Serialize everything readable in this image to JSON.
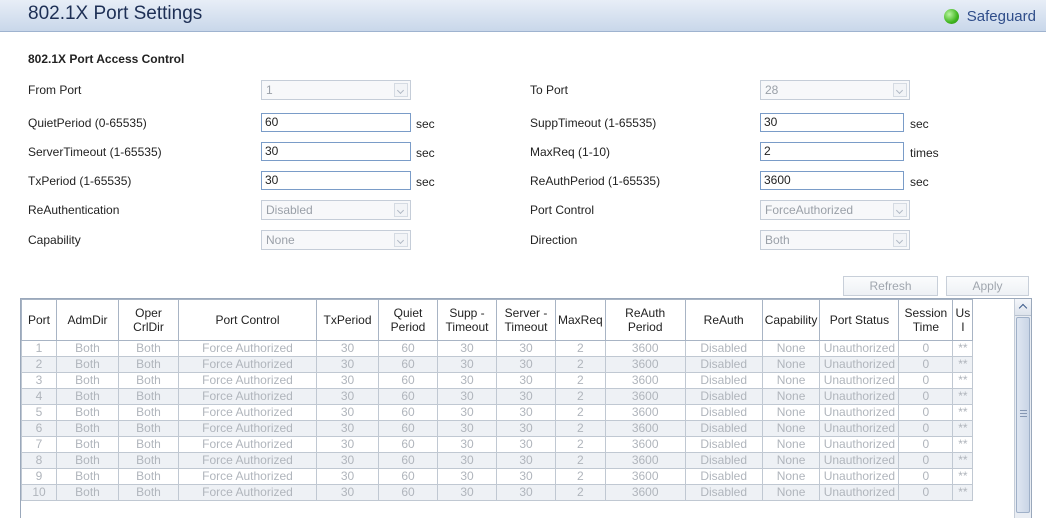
{
  "header": {
    "title": "802.1X Port Settings",
    "safeguard_label": "Safeguard",
    "safeguard_color": "#3fb51e"
  },
  "section": {
    "title": "802.1X Port Access Control"
  },
  "form": {
    "from_port": {
      "label": "From Port",
      "value": "1"
    },
    "to_port": {
      "label": "To Port",
      "value": "28"
    },
    "quiet_period": {
      "label": "QuietPeriod (0-65535)",
      "value": "60",
      "unit": "sec"
    },
    "supp_timeout": {
      "label": "SuppTimeout (1-65535)",
      "value": "30",
      "unit": "sec"
    },
    "server_timeout": {
      "label": "ServerTimeout (1-65535)",
      "value": "30",
      "unit": "sec"
    },
    "max_req": {
      "label": "MaxReq (1-10)",
      "value": "2",
      "unit": "times"
    },
    "tx_period": {
      "label": "TxPeriod (1-65535)",
      "value": "30",
      "unit": "sec"
    },
    "reauth_period": {
      "label": "ReAuthPeriod (1-65535)",
      "value": "3600",
      "unit": "sec"
    },
    "reauthentication": {
      "label": "ReAuthentication",
      "value": "Disabled"
    },
    "port_control": {
      "label": "Port Control",
      "value": "ForceAuthorized"
    },
    "capability": {
      "label": "Capability",
      "value": "None"
    },
    "direction": {
      "label": "Direction",
      "value": "Both"
    }
  },
  "buttons": {
    "refresh": "Refresh",
    "apply": "Apply"
  },
  "table": {
    "headers": [
      "Port",
      "AdmDir",
      "Oper CrlDir",
      "Port Control",
      "TxPeriod",
      "Quiet Period",
      "Supp - Timeout",
      "Server - Timeout",
      "MaxReq",
      "ReAuth Period",
      "ReAuth",
      "Capability",
      "Port Status",
      "Session Time",
      "Us I"
    ],
    "rows": [
      [
        "1",
        "Both",
        "Both",
        "Force Authorized",
        "30",
        "60",
        "30",
        "30",
        "2",
        "3600",
        "Disabled",
        "None",
        "Unauthorized",
        "0",
        "**"
      ],
      [
        "2",
        "Both",
        "Both",
        "Force Authorized",
        "30",
        "60",
        "30",
        "30",
        "2",
        "3600",
        "Disabled",
        "None",
        "Unauthorized",
        "0",
        "**"
      ],
      [
        "3",
        "Both",
        "Both",
        "Force Authorized",
        "30",
        "60",
        "30",
        "30",
        "2",
        "3600",
        "Disabled",
        "None",
        "Unauthorized",
        "0",
        "**"
      ],
      [
        "4",
        "Both",
        "Both",
        "Force Authorized",
        "30",
        "60",
        "30",
        "30",
        "2",
        "3600",
        "Disabled",
        "None",
        "Unauthorized",
        "0",
        "**"
      ],
      [
        "5",
        "Both",
        "Both",
        "Force Authorized",
        "30",
        "60",
        "30",
        "30",
        "2",
        "3600",
        "Disabled",
        "None",
        "Unauthorized",
        "0",
        "**"
      ],
      [
        "6",
        "Both",
        "Both",
        "Force Authorized",
        "30",
        "60",
        "30",
        "30",
        "2",
        "3600",
        "Disabled",
        "None",
        "Unauthorized",
        "0",
        "**"
      ],
      [
        "7",
        "Both",
        "Both",
        "Force Authorized",
        "30",
        "60",
        "30",
        "30",
        "2",
        "3600",
        "Disabled",
        "None",
        "Unauthorized",
        "0",
        "**"
      ],
      [
        "8",
        "Both",
        "Both",
        "Force Authorized",
        "30",
        "60",
        "30",
        "30",
        "2",
        "3600",
        "Disabled",
        "None",
        "Unauthorized",
        "0",
        "**"
      ],
      [
        "9",
        "Both",
        "Both",
        "Force Authorized",
        "30",
        "60",
        "30",
        "30",
        "2",
        "3600",
        "Disabled",
        "None",
        "Unauthorized",
        "0",
        "**"
      ],
      [
        "10",
        "Both",
        "Both",
        "Force Authorized",
        "30",
        "60",
        "30",
        "30",
        "2",
        "3600",
        "Disabled",
        "None",
        "Unauthorized",
        "0",
        "**"
      ]
    ]
  }
}
